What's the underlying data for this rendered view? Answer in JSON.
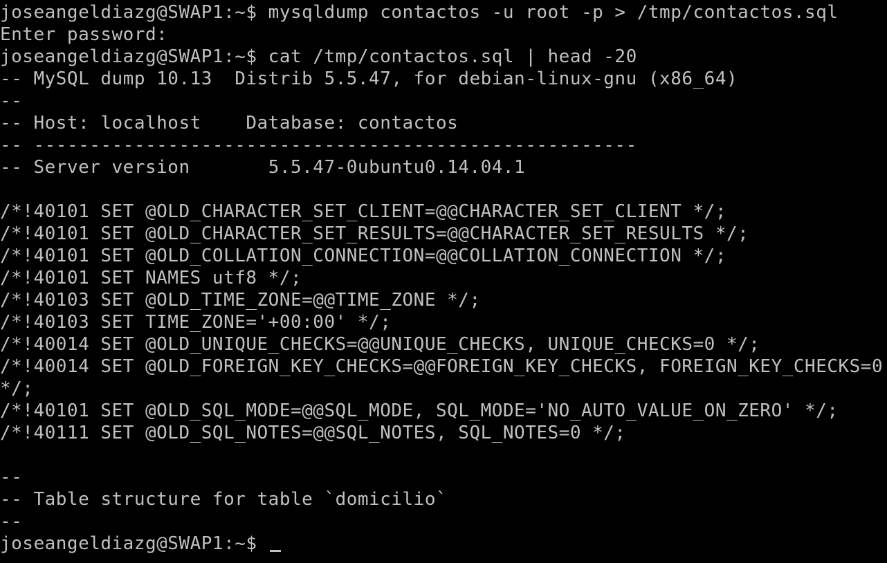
{
  "terminal": {
    "colors": {
      "background": "#000000",
      "foreground": "#c0c0c0"
    },
    "lines": [
      "joseangeldiazg@SWAP1:~$ mysqldump contactos -u root -p > /tmp/contactos.sql",
      "Enter password:",
      "joseangeldiazg@SWAP1:~$ cat /tmp/contactos.sql | head -20",
      "-- MySQL dump 10.13  Distrib 5.5.47, for debian-linux-gnu (x86_64)",
      "--",
      "-- Host: localhost    Database: contactos",
      "-- ------------------------------------------------------",
      "-- Server version\t5.5.47-0ubuntu0.14.04.1",
      "",
      "/*!40101 SET @OLD_CHARACTER_SET_CLIENT=@@CHARACTER_SET_CLIENT */;",
      "/*!40101 SET @OLD_CHARACTER_SET_RESULTS=@@CHARACTER_SET_RESULTS */;",
      "/*!40101 SET @OLD_COLLATION_CONNECTION=@@COLLATION_CONNECTION */;",
      "/*!40101 SET NAMES utf8 */;",
      "/*!40103 SET @OLD_TIME_ZONE=@@TIME_ZONE */;",
      "/*!40103 SET TIME_ZONE='+00:00' */;",
      "/*!40014 SET @OLD_UNIQUE_CHECKS=@@UNIQUE_CHECKS, UNIQUE_CHECKS=0 */;",
      "/*!40014 SET @OLD_FOREIGN_KEY_CHECKS=@@FOREIGN_KEY_CHECKS, FOREIGN_KEY_CHECKS=0",
      "*/;",
      "/*!40101 SET @OLD_SQL_MODE=@@SQL_MODE, SQL_MODE='NO_AUTO_VALUE_ON_ZERO' */;",
      "/*!40111 SET @OLD_SQL_NOTES=@@SQL_NOTES, SQL_NOTES=0 */;",
      "",
      "--",
      "-- Table structure for table `domicilio`",
      "--"
    ],
    "prompt": "joseangeldiazg@SWAP1:~$ "
  }
}
